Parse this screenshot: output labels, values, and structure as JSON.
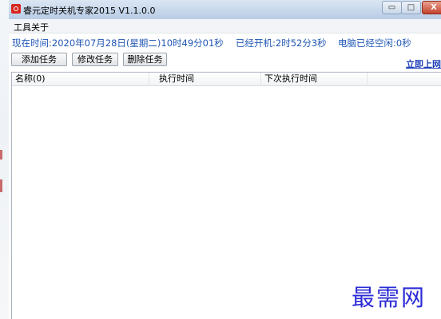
{
  "window": {
    "title": "睿元定时关机专家2015 V1.1.0.0",
    "controls": {
      "minimize": "▭",
      "maximize": "□",
      "close": "X"
    }
  },
  "menu": {
    "tools": "工具",
    "about": "关于"
  },
  "status": {
    "current_time": "现在时间:2020年07月28日(星期二)10时49分01秒",
    "uptime": "已经开机:2时52分3秒",
    "idle": "电脑已经空闲:0秒"
  },
  "toolbar": {
    "add_label": "添加任务",
    "edit_label": "修改任务",
    "delete_label": "删除任务"
  },
  "link_label": "立即上网",
  "task_list": {
    "columns": [
      "名称(0)",
      "执行时间",
      "下次执行时间"
    ],
    "rows": []
  },
  "watermark": "最需网",
  "colors": {
    "status_text": "#1f56b5",
    "link": "#1f3fb8",
    "watermark": "#2b2bd6"
  }
}
